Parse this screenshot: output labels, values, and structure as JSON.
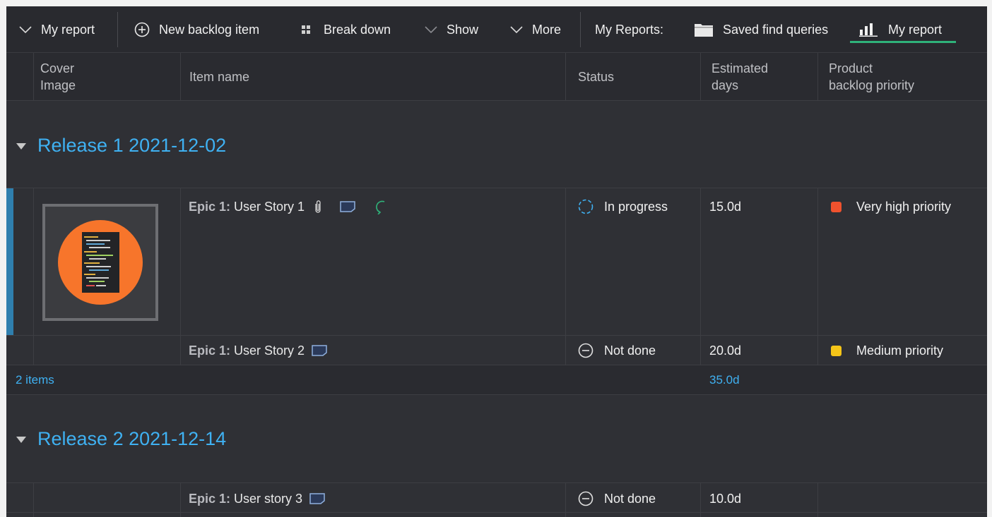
{
  "toolbar": {
    "my_report_dropdown": "My report",
    "new_backlog_item": "New backlog item",
    "break_down": "Break down",
    "show": "Show",
    "more": "More",
    "my_reports_label": "My Reports:",
    "saved_find_queries": "Saved find queries",
    "my_report_tab": "My report"
  },
  "columns": {
    "cover_image": "Cover\nImage",
    "item_name": "Item name",
    "status": "Status",
    "estimated_days": "Estimated\ndays",
    "product_backlog_priority": "Product\nbacklog priority"
  },
  "groups": [
    {
      "title": "Release 1 2021-12-02",
      "items": [
        {
          "epic": "Epic 1:",
          "name": "User Story 1",
          "status": "In progress",
          "estimate": "15.0d",
          "priority": "Very high priority",
          "priority_color": "#f0522e",
          "has_attachment": true,
          "has_comment": true,
          "has_cycle": true,
          "has_cover": true
        },
        {
          "epic": "Epic 1:",
          "name": "User Story 2",
          "status": "Not done",
          "estimate": "20.0d",
          "priority": "Medium priority",
          "priority_color": "#f5c518",
          "has_comment": true
        }
      ],
      "summary_count": "2 items",
      "summary_estimate": "35.0d"
    },
    {
      "title": "Release 2 2021-12-14",
      "items": [
        {
          "epic": "Epic 1:",
          "name": "User story 3",
          "status": "Not done",
          "estimate": "10.0d",
          "priority": "",
          "has_comment": true
        }
      ]
    }
  ],
  "colors": {
    "accent": "#3fb1f2",
    "selected_tab": "#2fb37a",
    "background": "#2f3035",
    "row_marker": "#2f7fae",
    "cover_orange": "#f7752b"
  },
  "icons": {
    "dropdown": "chevron-down-icon",
    "new_item": "plus-circle-icon",
    "break_down": "grid-icon",
    "saved_queries": "folder-icon",
    "report": "bar-chart-icon",
    "attachment": "paperclip-icon",
    "comment": "comment-icon",
    "cycle": "refresh-icon",
    "in_progress": "dashed-circle-icon",
    "not_done": "minus-circle-icon"
  }
}
